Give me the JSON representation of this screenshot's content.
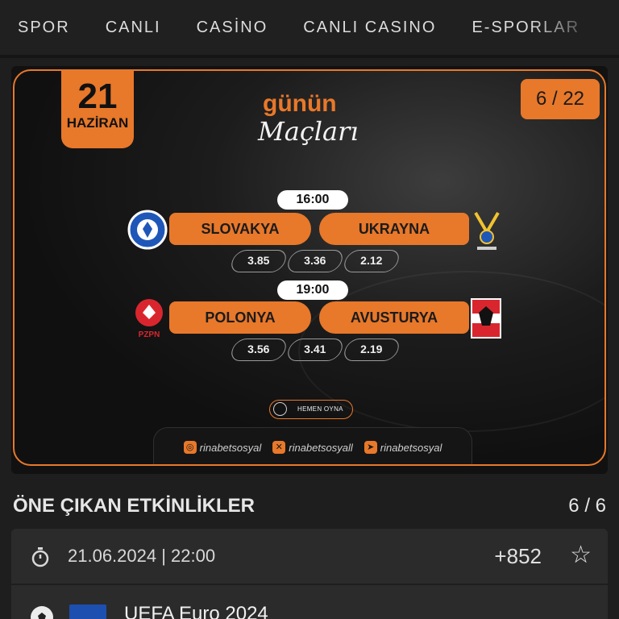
{
  "nav": {
    "items": [
      "SPOR",
      "CANLI",
      "CASİNO",
      "CANLI CASINO",
      "E-SPORLAR"
    ]
  },
  "banner": {
    "date_day": "21",
    "date_month": "HAZİRAN",
    "counter": "6 / 22",
    "title_top": "günün",
    "title_bottom": "Maçları",
    "matches": [
      {
        "time": "16:00",
        "home": "SLOVAKYA",
        "away": "UKRAYNA",
        "odds": [
          "3.85",
          "3.36",
          "2.12"
        ]
      },
      {
        "time": "19:00",
        "home": "POLONYA",
        "away": "AVUSTURYA",
        "odds": [
          "3.56",
          "3.41",
          "2.19"
        ]
      }
    ],
    "cta_label": "HEMEN OYNA",
    "socials": [
      "rinabetsosyal",
      "rinabetsosyall",
      "rinabetsosyal"
    ],
    "social_icons": [
      "instagram-icon",
      "x-icon",
      "telegram-icon"
    ]
  },
  "section": {
    "title": "ÖNE ÇIKAN ETKİNLİKLER",
    "count": "6 / 6"
  },
  "event": {
    "datetime": "21.06.2024 | 22:00",
    "markets": "+852",
    "league": "UEFA Euro 2024"
  },
  "colors": {
    "accent": "#e8782a",
    "background": "#1e1e1e",
    "card": "#2b2b2b"
  }
}
